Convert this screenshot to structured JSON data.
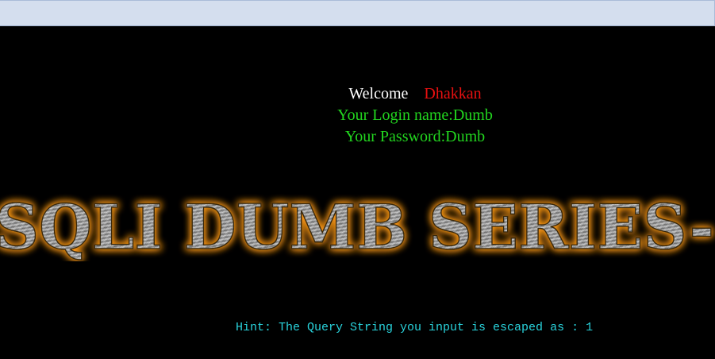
{
  "welcome": {
    "label": "Welcome",
    "name": "Dhakkan"
  },
  "credentials": {
    "login": "Your Login name:Dumb",
    "password": "Your Password:Dumb"
  },
  "banner": {
    "text": "SQLI DUMB SERIES-"
  },
  "hint": {
    "text": "Hint: The Query String you input is escaped as : 1"
  },
  "colors": {
    "background": "#000000",
    "welcome": "#ffffff",
    "name": "#e81010",
    "credentials": "#22d61f",
    "hint": "#29d3dc",
    "banner_glow": "#ff9a1a"
  }
}
